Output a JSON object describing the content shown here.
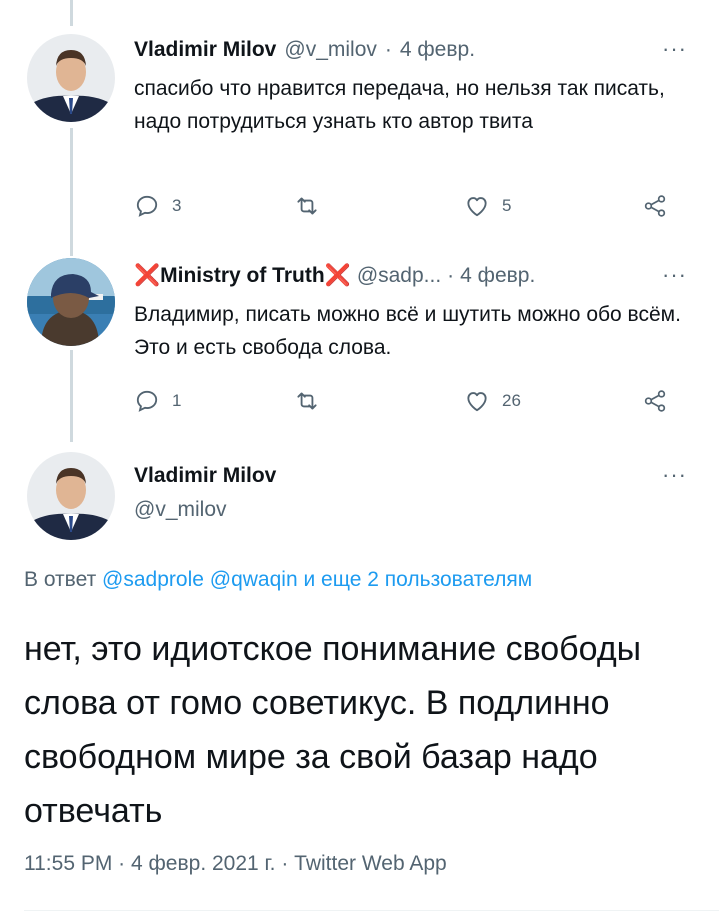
{
  "colors": {
    "accent": "#1d9bf0",
    "muted": "#536471",
    "text": "#0f1419",
    "x_mark": "#e0245e"
  },
  "tweet1": {
    "name": "Vladimir Milov",
    "handle": "@v_milov",
    "sep": "·",
    "date": "4 февр.",
    "more": "···",
    "text": "спасибо что нравится передача, но нельзя так писать, надо потрудиться узнать кто автор твита",
    "replies": "3",
    "retweets": "",
    "likes": "5"
  },
  "tweet2": {
    "x_left": "❌",
    "name": "Ministry of Truth",
    "x_right": "❌",
    "handle": "@sadp...",
    "sep": "·",
    "date": "4 февр.",
    "more": "···",
    "text": "Владимир, писать можно всё и шутить можно обо всём. Это и есть свобода слова.",
    "replies": "1",
    "retweets": "",
    "likes": "26"
  },
  "main_tweet": {
    "name": "Vladimir Milov",
    "handle": "@v_milov",
    "more": "···",
    "reply_prefix": "В ответ",
    "reply_user1": "@sadprole",
    "reply_user2": "@qwaqin",
    "reply_suffix": "и еще 2 пользователям",
    "text": "нет, это идиотское понимание свободы слова от гомо советикус. В подлинно свободном мире за свой базар надо отвечать",
    "time": "11:55 PM",
    "sep1": "·",
    "date": "4 февр. 2021 г.",
    "sep2": "·",
    "source": "Twitter Web App"
  }
}
